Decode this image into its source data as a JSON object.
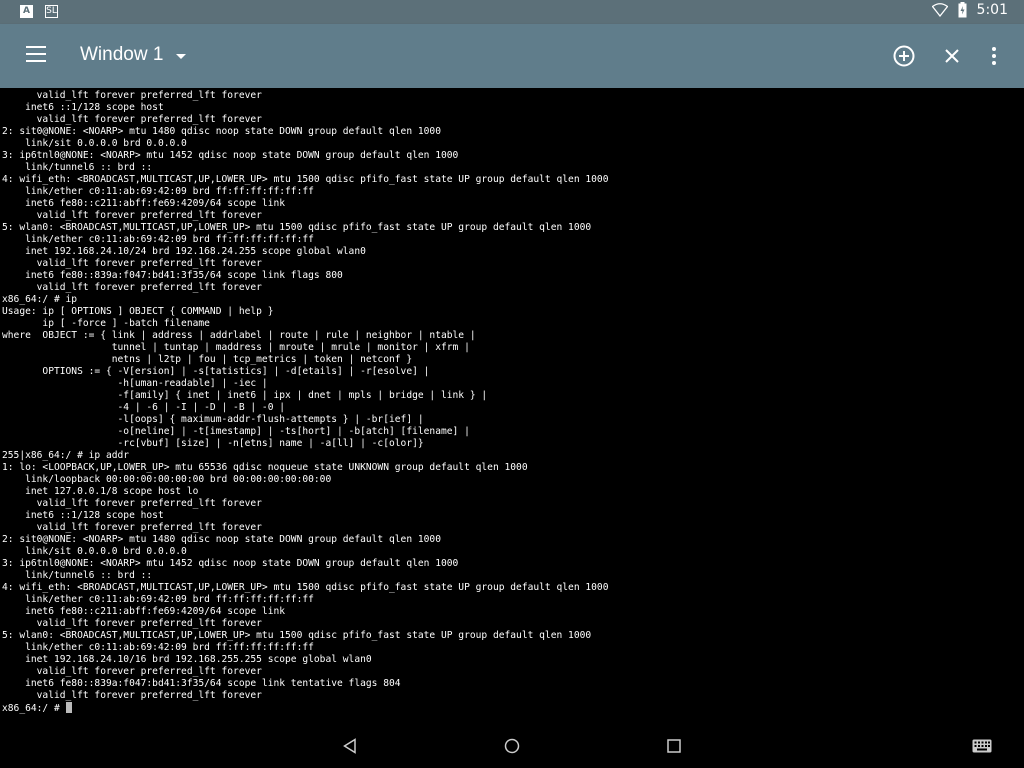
{
  "status_bar": {
    "left_icons": [
      "A",
      "SL"
    ],
    "time": "5:01"
  },
  "app_bar": {
    "title": "Window 1",
    "actions": [
      "add-window",
      "close-window",
      "more-options"
    ]
  },
  "terminal": {
    "lines": [
      "      valid_lft forever preferred_lft forever",
      "    inet6 ::1/128 scope host",
      "      valid_lft forever preferred_lft forever",
      "2: sit0@NONE: <NOARP> mtu 1480 qdisc noop state DOWN group default qlen 1000",
      "    link/sit 0.0.0.0 brd 0.0.0.0",
      "3: ip6tnl0@NONE: <NOARP> mtu 1452 qdisc noop state DOWN group default qlen 1000",
      "    link/tunnel6 :: brd ::",
      "4: wifi_eth: <BROADCAST,MULTICAST,UP,LOWER_UP> mtu 1500 qdisc pfifo_fast state UP group default qlen 1000",
      "    link/ether c0:11:ab:69:42:09 brd ff:ff:ff:ff:ff:ff",
      "    inet6 fe80::c211:abff:fe69:4209/64 scope link",
      "      valid_lft forever preferred_lft forever",
      "5: wlan0: <BROADCAST,MULTICAST,UP,LOWER_UP> mtu 1500 qdisc pfifo_fast state UP group default qlen 1000",
      "    link/ether c0:11:ab:69:42:09 brd ff:ff:ff:ff:ff:ff",
      "    inet 192.168.24.10/24 brd 192.168.24.255 scope global wlan0",
      "      valid_lft forever preferred_lft forever",
      "    inet6 fe80::839a:f047:bd41:3f35/64 scope link flags 800",
      "      valid_lft forever preferred_lft forever",
      "x86_64:/ # ip",
      "Usage: ip [ OPTIONS ] OBJECT { COMMAND | help }",
      "       ip [ -force ] -batch filename",
      "where  OBJECT := { link | address | addrlabel | route | rule | neighbor | ntable |",
      "                   tunnel | tuntap | maddress | mroute | mrule | monitor | xfrm |",
      "                   netns | l2tp | fou | tcp_metrics | token | netconf }",
      "       OPTIONS := { -V[ersion] | -s[tatistics] | -d[etails] | -r[esolve] |",
      "                    -h[uman-readable] | -iec |",
      "                    -f[amily] { inet | inet6 | ipx | dnet | mpls | bridge | link } |",
      "                    -4 | -6 | -I | -D | -B | -0 |",
      "                    -l[oops] { maximum-addr-flush-attempts } | -br[ief] |",
      "                    -o[neline] | -t[imestamp] | -ts[hort] | -b[atch] [filename] |",
      "                    -rc[vbuf] [size] | -n[etns] name | -a[ll] | -c[olor]}",
      "255|x86_64:/ # ip addr",
      "1: lo: <LOOPBACK,UP,LOWER_UP> mtu 65536 qdisc noqueue state UNKNOWN group default qlen 1000",
      "    link/loopback 00:00:00:00:00:00 brd 00:00:00:00:00:00",
      "    inet 127.0.0.1/8 scope host lo",
      "      valid_lft forever preferred_lft forever",
      "    inet6 ::1/128 scope host",
      "      valid_lft forever preferred_lft forever",
      "2: sit0@NONE: <NOARP> mtu 1480 qdisc noop state DOWN group default qlen 1000",
      "    link/sit 0.0.0.0 brd 0.0.0.0",
      "3: ip6tnl0@NONE: <NOARP> mtu 1452 qdisc noop state DOWN group default qlen 1000",
      "    link/tunnel6 :: brd ::",
      "4: wifi_eth: <BROADCAST,MULTICAST,UP,LOWER_UP> mtu 1500 qdisc pfifo_fast state UP group default qlen 1000",
      "    link/ether c0:11:ab:69:42:09 brd ff:ff:ff:ff:ff:ff",
      "    inet6 fe80::c211:abff:fe69:4209/64 scope link",
      "      valid_lft forever preferred_lft forever",
      "5: wlan0: <BROADCAST,MULTICAST,UP,LOWER_UP> mtu 1500 qdisc pfifo_fast state UP group default qlen 1000",
      "    link/ether c0:11:ab:69:42:09 brd ff:ff:ff:ff:ff:ff",
      "    inet 192.168.24.10/16 brd 192.168.255.255 scope global wlan0",
      "      valid_lft forever preferred_lft forever",
      "    inet6 fe80::839a:f047:bd41:3f35/64 scope link tentative flags 804",
      "      valid_lft forever preferred_lft forever"
    ],
    "prompt": "x86_64:/ # "
  },
  "nav_bar": {
    "buttons": [
      "back",
      "home",
      "recents",
      "keyboard"
    ]
  },
  "colors": {
    "status_bar": "#5c7079",
    "app_bar": "#607d8b",
    "terminal_bg": "#000000",
    "terminal_text": "#ffffff"
  }
}
